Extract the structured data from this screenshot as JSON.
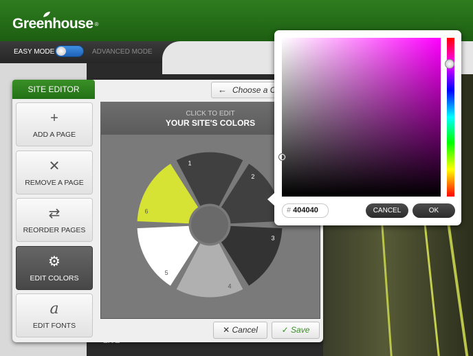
{
  "header": {
    "logo_text": "Greenhouse",
    "logo_mark": "®"
  },
  "modes": {
    "easy_label": "EASY MODE",
    "advanced_label": "ADVANCED MODE"
  },
  "editor": {
    "tab_label": "SITE EDITOR",
    "menu": [
      {
        "label": "ADD A PAGE",
        "icon": "plus-icon",
        "glyph": "+"
      },
      {
        "label": "REMOVE A PAGE",
        "icon": "x-icon",
        "glyph": "✕"
      },
      {
        "label": "REORDER PAGES",
        "icon": "swap-arrows-icon",
        "glyph": "⇄"
      },
      {
        "label": "EDIT COLORS",
        "icon": "gear-icon",
        "glyph": "⚙"
      },
      {
        "label": "EDIT FONTS",
        "icon": "font-a-icon",
        "glyph": "a"
      }
    ],
    "choose_label": "Choose a Co",
    "colors_sub": "CLICK TO EDIT",
    "colors_main": "YOUR SITE'S COLORS",
    "swatches": [
      {
        "num": "1",
        "color": "#404040"
      },
      {
        "num": "2",
        "color": "#404040"
      },
      {
        "num": "3",
        "color": "#333333"
      },
      {
        "num": "4",
        "color": "#b0b0b0"
      },
      {
        "num": "5",
        "color": "#ffffff"
      },
      {
        "num": "6",
        "color": "#d6e234"
      }
    ],
    "cancel_label": "Cancel",
    "save_label": "Save"
  },
  "picker": {
    "hex_prefix": "#",
    "hex_value": "404040",
    "cancel_label": "CANCEL",
    "ok_label": "OK"
  },
  "background": {
    "live_label": "LIVE"
  }
}
